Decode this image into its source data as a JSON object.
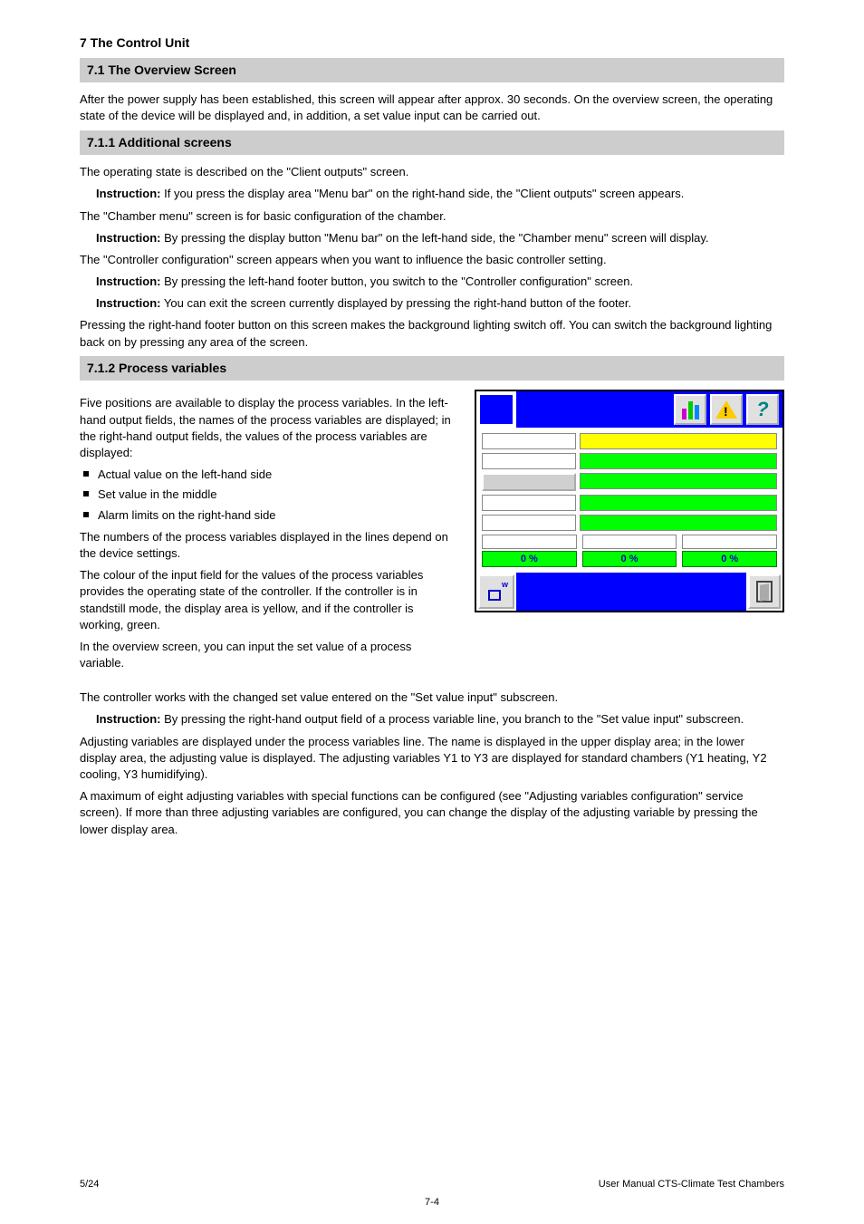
{
  "doc": {
    "chapter": "7  The Control Unit",
    "footer_left": "5/24",
    "footer_right": "User Manual CTS-Climate Test Chambers",
    "page": "7-4"
  },
  "sections": {
    "s71": {
      "title": "7.1  The Overview Screen",
      "body": "After the power supply has been established, this screen will appear after approx. 30 seconds. On the overview screen, the operating state of the device will be displayed and, in addition, a set value input can be carried out."
    },
    "s711": {
      "title": "7.1.1  Additional screens",
      "inst_label": "Instruction:",
      "p1": "The operating state is described on the \"Client outputs\" screen.",
      "inst1": "If you press the display area \"Menu bar\" on the right-hand side, the \"Client outputs\" screen appears.",
      "p2": "The \"Chamber menu\" screen is for basic configuration of the chamber.",
      "inst2": "By pressing the display button \"Menu bar\" on the left-hand side, the \"Chamber menu\" screen will display.",
      "p3": "The \"Controller configuration\" screen appears when you want to influence the basic controller setting.",
      "inst3": "By pressing the left-hand footer button, you switch to the \"Controller configuration\" screen.",
      "inst4": "You can exit the screen currently displayed by pressing the right-hand button of the footer.",
      "p4": "Pressing the right-hand footer button on this screen makes the background lighting switch off. You can switch the background lighting back on by pressing any area of the screen."
    },
    "s712": {
      "title": "7.1.2  Process variables",
      "p1": "Five positions are available to display the process variables. In the left-hand output fields, the names of the process variables are displayed; in the right-hand output fields, the values of the process variables are displayed:",
      "b1": "Actual value on the left-hand side",
      "b2": "Set value in the middle",
      "b3": "Alarm limits on the right-hand side",
      "p2": "The numbers of the process variables displayed in the lines depend on the device settings.",
      "p3": "The colour of the input field for the values of the process variables provides the operating state of the controller. If the controller is in standstill mode, the display area is yellow, and if the controller is working, green.",
      "p4": "In the overview screen, you can input the set value of a process variable.",
      "p5": "The controller works with the changed set value entered on the \"Set value input\" subscreen.",
      "inst1": "By pressing the right-hand output field of a process variable line, you branch to the \"Set value input\" subscreen.",
      "p6": "Adjusting variables are displayed under the process variables line. The name is displayed in the upper display area; in the lower display area, the adjusting value is displayed. The adjusting variables Y1 to Y3 are displayed for standard chambers (Y1 heating, Y2 cooling, Y3 humidifying).",
      "p7": "A maximum of eight adjusting variables with special functions can be configured (see \"Adjusting variables configuration\" service screen). If more than three adjusting variables are configured, you can change the display of the adjusting variable by pressing the lower display area."
    }
  },
  "panel": {
    "outputs": [
      "0 %",
      "0 %",
      "0 %"
    ]
  }
}
